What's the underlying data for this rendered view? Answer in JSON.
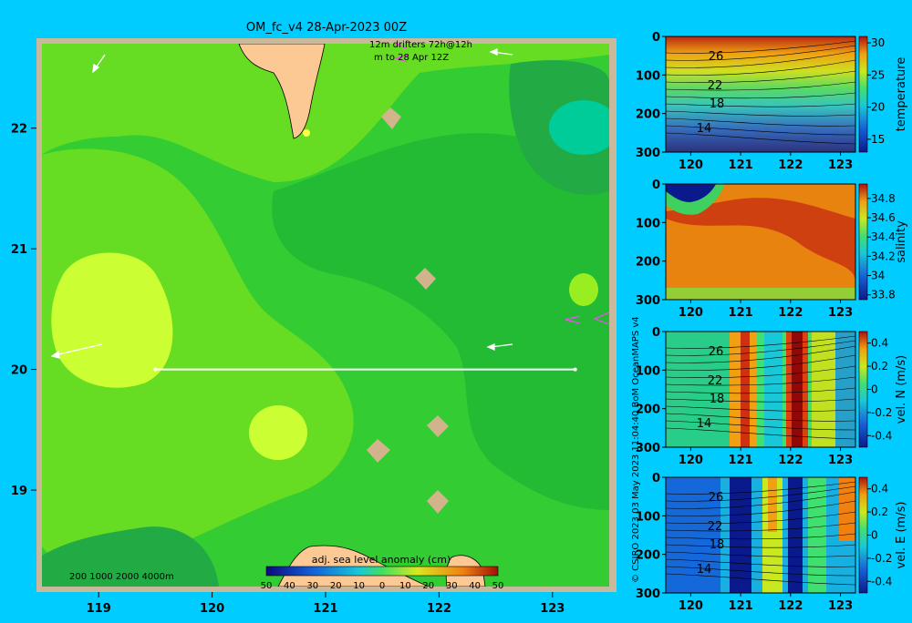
{
  "header": {
    "title": "OM_fc_v4  28-Apr-2023 00Z",
    "legend_line1": "12m    drifters 72h@12h",
    "legend_line2": "m      to 28 Apr 12Z"
  },
  "colors": {
    "background": "#00ccff",
    "land": "#fcc894",
    "frame": "#c8b89c",
    "drifter": "#ff44ff"
  },
  "map": {
    "lon_range": [
      118.5,
      123.5
    ],
    "lat_range": [
      18.2,
      22.7
    ],
    "lon_ticks": [
      "119",
      "120",
      "121",
      "122",
      "123"
    ],
    "lat_ticks": [
      "19",
      "20",
      "21",
      "22"
    ],
    "section_line": {
      "lon": [
        119.5,
        123.2
      ],
      "lat": [
        20.0,
        20.0
      ]
    },
    "depth_legend": "200  1000  2000  4000m",
    "colorbar_title": "adj. sea level anomaly (cm)",
    "colorbar_ticks": [
      "-50",
      "-40",
      "-30",
      "-20",
      "-10",
      "0",
      "10",
      "20",
      "30",
      "40",
      "50"
    ],
    "colorbar_ticks_shown": [
      "50",
      "40",
      "30",
      "20",
      "10",
      "0",
      "10",
      "20",
      "30",
      "40",
      "50"
    ],
    "colorbar_range": [
      -50,
      50
    ]
  },
  "chart_data": [
    {
      "type": "heatmap",
      "title": "",
      "ylabel": "temperature",
      "x_ticks": [
        "120",
        "121",
        "122",
        "123"
      ],
      "y_ticks": [
        "0",
        "100",
        "200",
        "300"
      ],
      "xlim": [
        119.5,
        123.3
      ],
      "ylim": [
        300,
        0
      ],
      "colorbar_ticks": [
        "15",
        "20",
        "25",
        "30"
      ],
      "colorbar_range": [
        13,
        31
      ],
      "contour_labels": [
        "26",
        "22",
        "18",
        "14"
      ]
    },
    {
      "type": "heatmap",
      "title": "",
      "ylabel": "salinity",
      "x_ticks": [
        "120",
        "121",
        "122",
        "123"
      ],
      "y_ticks": [
        "0",
        "100",
        "200",
        "300"
      ],
      "xlim": [
        119.5,
        123.3
      ],
      "ylim": [
        300,
        0
      ],
      "colorbar_ticks": [
        "33.8",
        "34",
        "34.2",
        "34.4",
        "34.6",
        "34.8"
      ],
      "colorbar_range": [
        33.75,
        34.95
      ],
      "contour_labels": []
    },
    {
      "type": "heatmap",
      "title": "",
      "ylabel": "vel. N (m/s)",
      "x_ticks": [
        "120",
        "121",
        "122",
        "123"
      ],
      "y_ticks": [
        "0",
        "100",
        "200",
        "300"
      ],
      "xlim": [
        119.5,
        123.3
      ],
      "ylim": [
        300,
        0
      ],
      "colorbar_ticks": [
        "-0.4",
        "-0.2",
        "0",
        "0.2",
        "0.4"
      ],
      "colorbar_range": [
        -0.5,
        0.5
      ],
      "contour_labels": [
        "26",
        "22",
        "18",
        "14"
      ]
    },
    {
      "type": "heatmap",
      "title": "",
      "ylabel": "vel. E (m/s)",
      "x_ticks": [
        "120",
        "121",
        "122",
        "123"
      ],
      "y_ticks": [
        "0",
        "100",
        "200",
        "300"
      ],
      "xlim": [
        119.5,
        123.3
      ],
      "ylim": [
        300,
        0
      ],
      "colorbar_ticks": [
        "-0.4",
        "-0.2",
        "0",
        "0.2",
        "0.4"
      ],
      "colorbar_range": [
        -0.5,
        0.5
      ],
      "contour_labels": [
        "26",
        "22",
        "18",
        "14"
      ]
    }
  ],
  "footer": {
    "vertical_credit": "© CSIRO 2023   03 May 2023 11:04:40 BoM OceanMAPS v4"
  }
}
